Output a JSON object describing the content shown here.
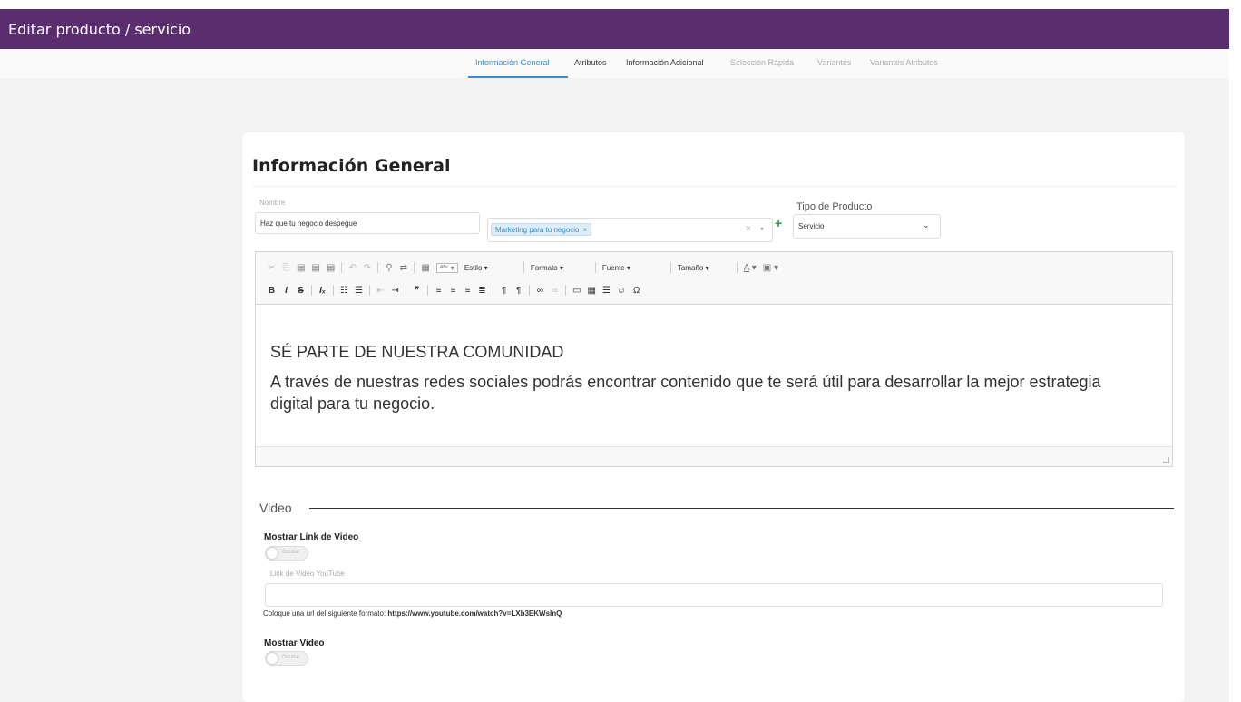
{
  "header": {
    "title": "Editar producto / servicio"
  },
  "tabs": [
    {
      "label": "Información General",
      "state": "active"
    },
    {
      "label": "Atributos",
      "state": "normal"
    },
    {
      "label": "Información Adicional",
      "state": "normal"
    },
    {
      "label": "Selección Rápida",
      "state": "disabled"
    },
    {
      "label": "Variantes",
      "state": "disabled"
    },
    {
      "label": "Variantes Atributos",
      "state": "disabled"
    }
  ],
  "card": {
    "title": "Información General",
    "nombre": {
      "label": "Nombre",
      "value": "Haz que tu negocio despegue"
    },
    "categoria": {
      "tag": "Marketing para tu negocio",
      "tag_remove": "×",
      "clear": "×",
      "caret": "▾",
      "add": "+"
    },
    "tipo_producto": {
      "label": "Tipo de Producto",
      "value": "Servicio",
      "caret": "⌄"
    }
  },
  "editor": {
    "toolbar": {
      "combos": {
        "estilo": "Estilo",
        "formato": "Formato",
        "fuente": "Fuente",
        "tamano": "Tamaño"
      },
      "row1_icons": [
        "cut-icon",
        "copy-icon",
        "paste-icon",
        "paste-text-icon",
        "paste-word-icon",
        "undo-icon",
        "redo-icon",
        "find-icon",
        "replace-icon",
        "select-all-icon",
        "spellcheck-icon",
        "text-color-icon",
        "bg-color-icon"
      ],
      "row2_icons": [
        "bold-icon",
        "italic-icon",
        "strike-icon",
        "remove-format-icon",
        "numbered-list-icon",
        "bulleted-list-icon",
        "outdent-icon",
        "indent-icon",
        "blockquote-icon",
        "align-left-icon",
        "align-center-icon",
        "align-right-icon",
        "justify-icon",
        "ltr-icon",
        "rtl-icon",
        "link-icon",
        "unlink-icon",
        "image-icon",
        "table-icon",
        "horizontal-rule-icon",
        "smiley-icon",
        "special-char-icon"
      ]
    },
    "content": {
      "heading": "SÉ PARTE DE NUESTRA COMUNIDAD",
      "paragraph": "A través de nuestras redes sociales podrás encontrar contenido que te será útil para desarrollar la mejor estrategia digital para tu negocio."
    }
  },
  "video": {
    "section_title": "Video",
    "mostrar_link": {
      "label": "Mostrar Link de Video",
      "toggle_text": "Ocultar",
      "state": "off"
    },
    "link_input": {
      "label": "Link de Video YouTube",
      "value": ""
    },
    "help": {
      "text": "Coloque una url del siguiente formato: ",
      "url": "https://www.youtube.com/watch?v=LXb3EKWsInQ"
    },
    "mostrar_video": {
      "label": "Mostrar Video",
      "toggle_text": "Ocultar",
      "state": "off"
    }
  }
}
